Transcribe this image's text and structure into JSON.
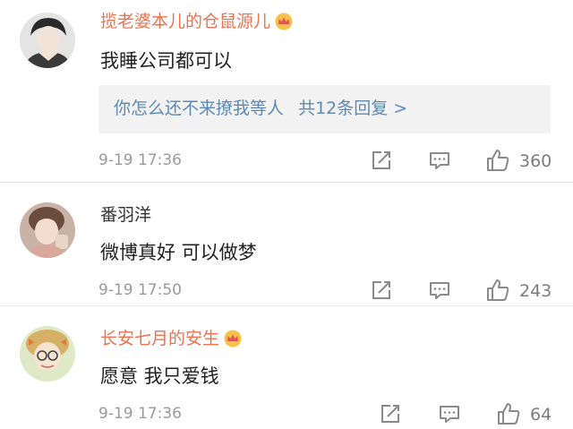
{
  "comments": [
    {
      "username": "揽老婆本儿的仓鼠源儿",
      "vip": true,
      "text": "我睡公司都可以",
      "reply": {
        "summary": "你怎么还不来撩我等人",
        "more": "共12条回复 >"
      },
      "time": "9-19 17:36",
      "likes": "360"
    },
    {
      "username": "番羽洋",
      "vip": false,
      "text": "微博真好 可以做梦",
      "time": "9-19 17:50",
      "likes": "243"
    },
    {
      "username": "长安七月的安生",
      "vip": true,
      "text": "愿意 我只爱钱",
      "time": "9-19 17:36",
      "likes": "64"
    }
  ],
  "colors": {
    "vip_name": "#eb7350",
    "reply_link": "#5d8ab5",
    "meta": "#9a9a9a"
  },
  "icons": [
    "avatar",
    "vip-crown-icon",
    "repost-icon",
    "comment-icon",
    "like-icon"
  ]
}
